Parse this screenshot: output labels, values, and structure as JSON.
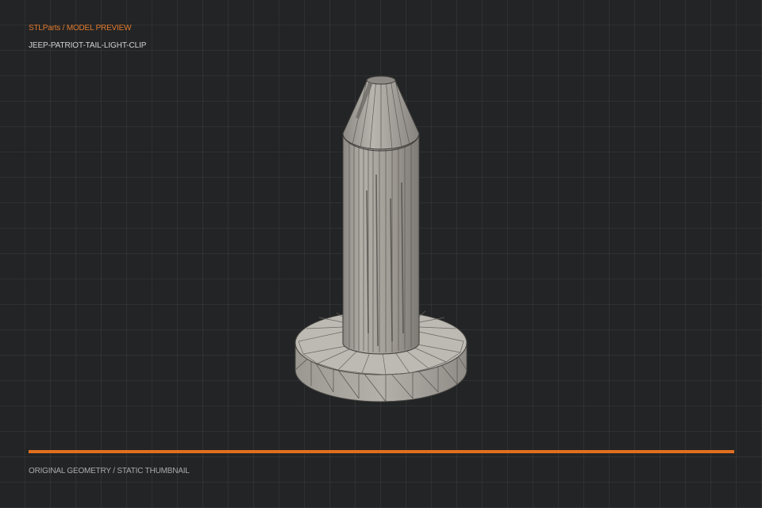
{
  "header": {
    "breadcrumb": "STLParts / MODEL PREVIEW",
    "model_name": "JEEP-PATRIOT-TAIL-LIGHT-CLIP"
  },
  "preview": {
    "icon": "3d-model-render"
  },
  "footer": {
    "caption": "ORIGINAL GEOMETRY / STATIC THUMBNAIL"
  },
  "colors": {
    "background": "#232425",
    "accent": "#e06f1f",
    "model_surface": "#a8a49f",
    "model_edges": "#3f3d3b"
  }
}
